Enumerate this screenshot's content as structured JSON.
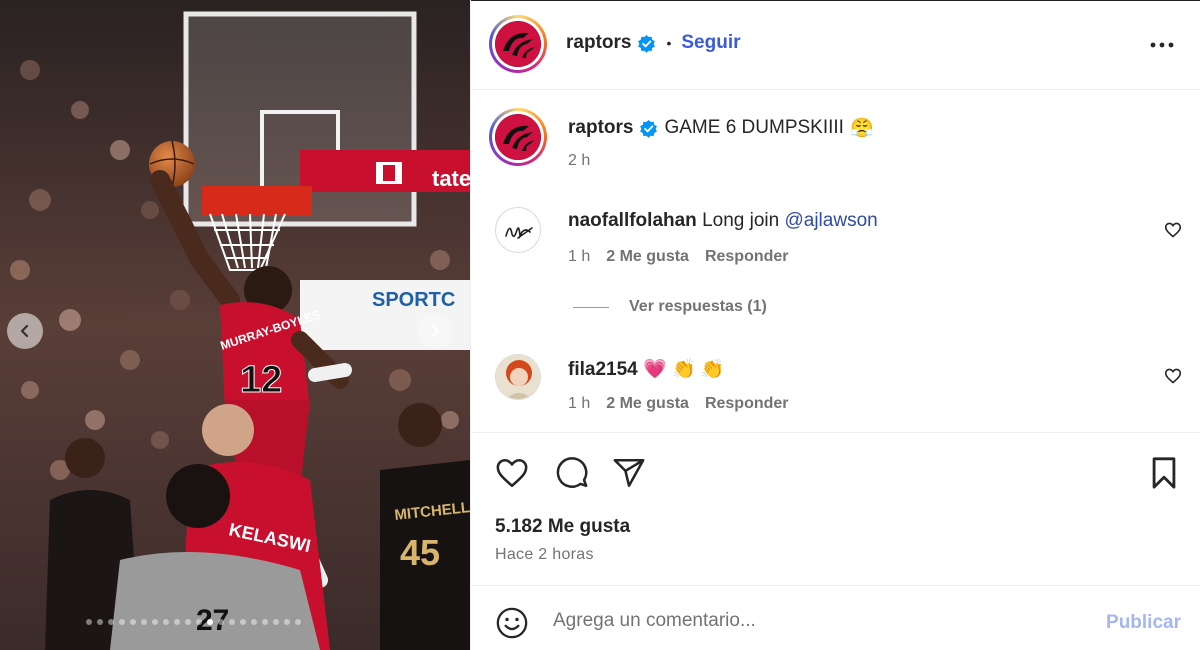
{
  "post": {
    "username": "raptors",
    "follow_label": "Seguir",
    "separator": "•",
    "caption": "GAME 6 DUMPSKIIII",
    "caption_emoji": "😤",
    "caption_time": "2 h"
  },
  "media": {
    "jersey_name": "MURRAY-BOYLES",
    "jersey_number": "12",
    "opponent_name": "MITCHELL",
    "opponent_number": "45",
    "foreground_name": "KELASWI",
    "ref_number": "27",
    "banner_text": "SPORTC",
    "board_text": "tate Fa",
    "slide_count": 20,
    "active_slide": 11
  },
  "comments": [
    {
      "username": "naofallfolahan",
      "text": "Long join ",
      "mention": "@ajlawson",
      "time": "1 h",
      "likes": "2 Me gusta",
      "reply_label": "Responder"
    },
    {
      "username": "fila2154",
      "text": "💗 👏 👏",
      "time": "1 h",
      "likes": "2 Me gusta",
      "reply_label": "Responder"
    }
  ],
  "view_replies": "Ver respuestas (1)",
  "stats": {
    "likes": "5.182 Me gusta",
    "time_ago": "Hace 2 horas"
  },
  "composer": {
    "placeholder": "Agrega un comentario...",
    "publish_label": "Publicar"
  },
  "colors": {
    "accent": "#3b5bdb",
    "raptors_red": "#ce1141",
    "verified": "#0095f6"
  },
  "icons": [
    "verified-icon",
    "more-icon",
    "heart-icon",
    "comment-icon",
    "share-icon",
    "bookmark-icon",
    "emoji-icon",
    "chevron-left-icon",
    "chevron-right-icon"
  ]
}
